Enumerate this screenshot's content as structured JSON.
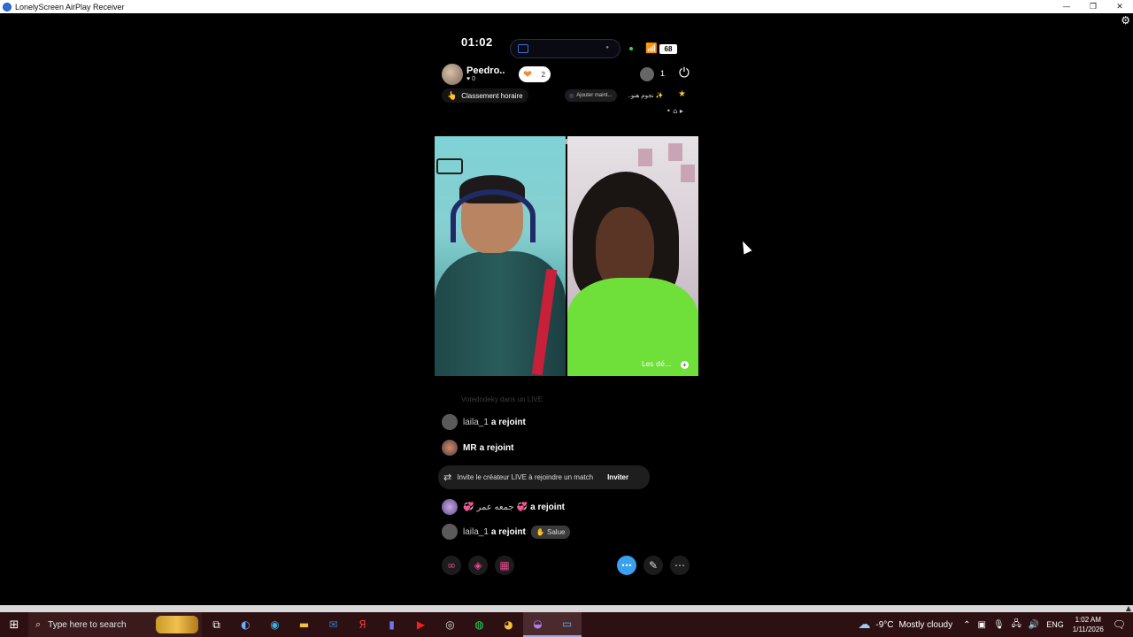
{
  "window": {
    "title": "LonelyScreen AirPlay Receiver",
    "minimize": "—",
    "restore": "❐",
    "close": "✕"
  },
  "status": {
    "time": "01:02",
    "battery": "68"
  },
  "host": {
    "name": "Peedro..",
    "likes": "♥ 0",
    "gift_count": "2",
    "viewer_count": "1"
  },
  "pills": {
    "ranking": "Classement horaire",
    "add": "Ajouter maint...",
    "arabic": "..نجوم هنو ✨"
  },
  "video": {
    "right_label": "Les dé..."
  },
  "chat": {
    "faded": "Votedodeky dans un LIVE",
    "rows": [
      {
        "user": "laila_1",
        "msg": "a rejoint"
      },
      {
        "user": "MR",
        "msg": "a rejoint"
      },
      {
        "user": "جمعه عمر",
        "msg": "a rejoint"
      },
      {
        "user": "laila_1",
        "msg": "a rejoint",
        "tag": "Salue"
      }
    ],
    "invite": {
      "text": "Invite le créateur LIVE à rejoindre un match",
      "button": "Inviter"
    }
  },
  "taskbar": {
    "search_placeholder": "Type here to search",
    "weather_temp": "-9°C",
    "weather_text": "Mostly cloudy",
    "lang": "ENG",
    "time": "1:02 AM",
    "date": "1/11/2026"
  },
  "colors": {
    "accent": "#3aa0f0",
    "pink": "#e04a8a",
    "taskbar": "#2d1012"
  }
}
